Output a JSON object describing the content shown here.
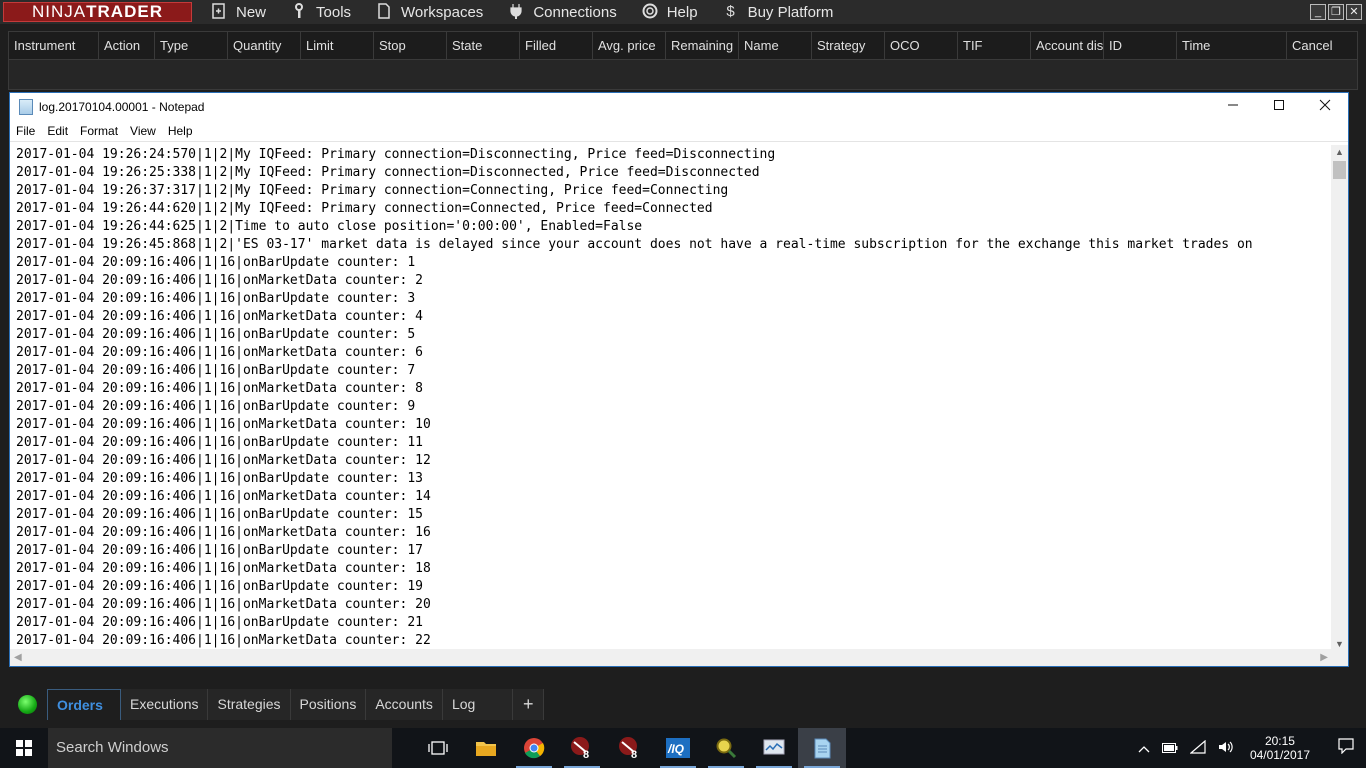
{
  "ninjatrader": {
    "logo_light": "NINJA",
    "logo_bold": "TRADER",
    "menu": [
      {
        "label": "New",
        "icon": "new-document-icon"
      },
      {
        "label": "Tools",
        "icon": "wrench-icon"
      },
      {
        "label": "Workspaces",
        "icon": "workspace-icon"
      },
      {
        "label": "Connections",
        "icon": "plug-icon"
      },
      {
        "label": "Help",
        "icon": "lifebuoy-icon"
      },
      {
        "label": "Buy Platform",
        "icon": "dollar-icon"
      }
    ],
    "orders_columns": [
      "Instrument",
      "Action",
      "Type",
      "Quantity",
      "Limit",
      "Stop",
      "State",
      "Filled",
      "Avg. price",
      "Remaining",
      "Name",
      "Strategy",
      "OCO",
      "TIF",
      "Account dis",
      "ID",
      "Time",
      "Cancel"
    ],
    "tabs": [
      "Orders",
      "Executions",
      "Strategies",
      "Positions",
      "Accounts",
      "Log"
    ],
    "tab_add": "+",
    "active_tab": "Orders",
    "connection_status_color": "#14a814"
  },
  "notepad": {
    "title": "log.20170104.00001 - Notepad",
    "menu": [
      "File",
      "Edit",
      "Format",
      "View",
      "Help"
    ],
    "lines": [
      "2017-01-04 19:26:24:570|1|2|My IQFeed: Primary connection=Disconnecting, Price feed=Disconnecting",
      "2017-01-04 19:26:25:338|1|2|My IQFeed: Primary connection=Disconnected, Price feed=Disconnected",
      "2017-01-04 19:26:37:317|1|2|My IQFeed: Primary connection=Connecting, Price feed=Connecting",
      "2017-01-04 19:26:44:620|1|2|My IQFeed: Primary connection=Connected, Price feed=Connected",
      "2017-01-04 19:26:44:625|1|2|Time to auto close position='0:00:00', Enabled=False",
      "2017-01-04 19:26:45:868|1|2|'ES 03-17' market data is delayed since your account does not have a real-time subscription for the exchange this market trades on",
      "2017-01-04 20:09:16:406|1|16|onBarUpdate counter: 1",
      "2017-01-04 20:09:16:406|1|16|onMarketData counter: 2",
      "2017-01-04 20:09:16:406|1|16|onBarUpdate counter: 3",
      "2017-01-04 20:09:16:406|1|16|onMarketData counter: 4",
      "2017-01-04 20:09:16:406|1|16|onBarUpdate counter: 5",
      "2017-01-04 20:09:16:406|1|16|onMarketData counter: 6",
      "2017-01-04 20:09:16:406|1|16|onBarUpdate counter: 7",
      "2017-01-04 20:09:16:406|1|16|onMarketData counter: 8",
      "2017-01-04 20:09:16:406|1|16|onBarUpdate counter: 9",
      "2017-01-04 20:09:16:406|1|16|onMarketData counter: 10",
      "2017-01-04 20:09:16:406|1|16|onBarUpdate counter: 11",
      "2017-01-04 20:09:16:406|1|16|onMarketData counter: 12",
      "2017-01-04 20:09:16:406|1|16|onBarUpdate counter: 13",
      "2017-01-04 20:09:16:406|1|16|onMarketData counter: 14",
      "2017-01-04 20:09:16:406|1|16|onBarUpdate counter: 15",
      "2017-01-04 20:09:16:406|1|16|onMarketData counter: 16",
      "2017-01-04 20:09:16:406|1|16|onBarUpdate counter: 17",
      "2017-01-04 20:09:16:406|1|16|onMarketData counter: 18",
      "2017-01-04 20:09:16:406|1|16|onBarUpdate counter: 19",
      "2017-01-04 20:09:16:406|1|16|onMarketData counter: 20",
      "2017-01-04 20:09:16:406|1|16|onBarUpdate counter: 21",
      "2017-01-04 20:09:16:406|1|16|onMarketData counter: 22"
    ]
  },
  "taskbar": {
    "search_placeholder": "Search Windows",
    "apps": [
      "task-view-icon",
      "file-explorer-icon",
      "chrome-icon",
      "ninjatrader8-icon",
      "ninjatrader8-icon",
      "iqfeed-icon",
      "search-tool-icon",
      "monitor-tool-icon",
      "notepad-icon"
    ],
    "time": "20:15",
    "date": "04/01/2017"
  }
}
